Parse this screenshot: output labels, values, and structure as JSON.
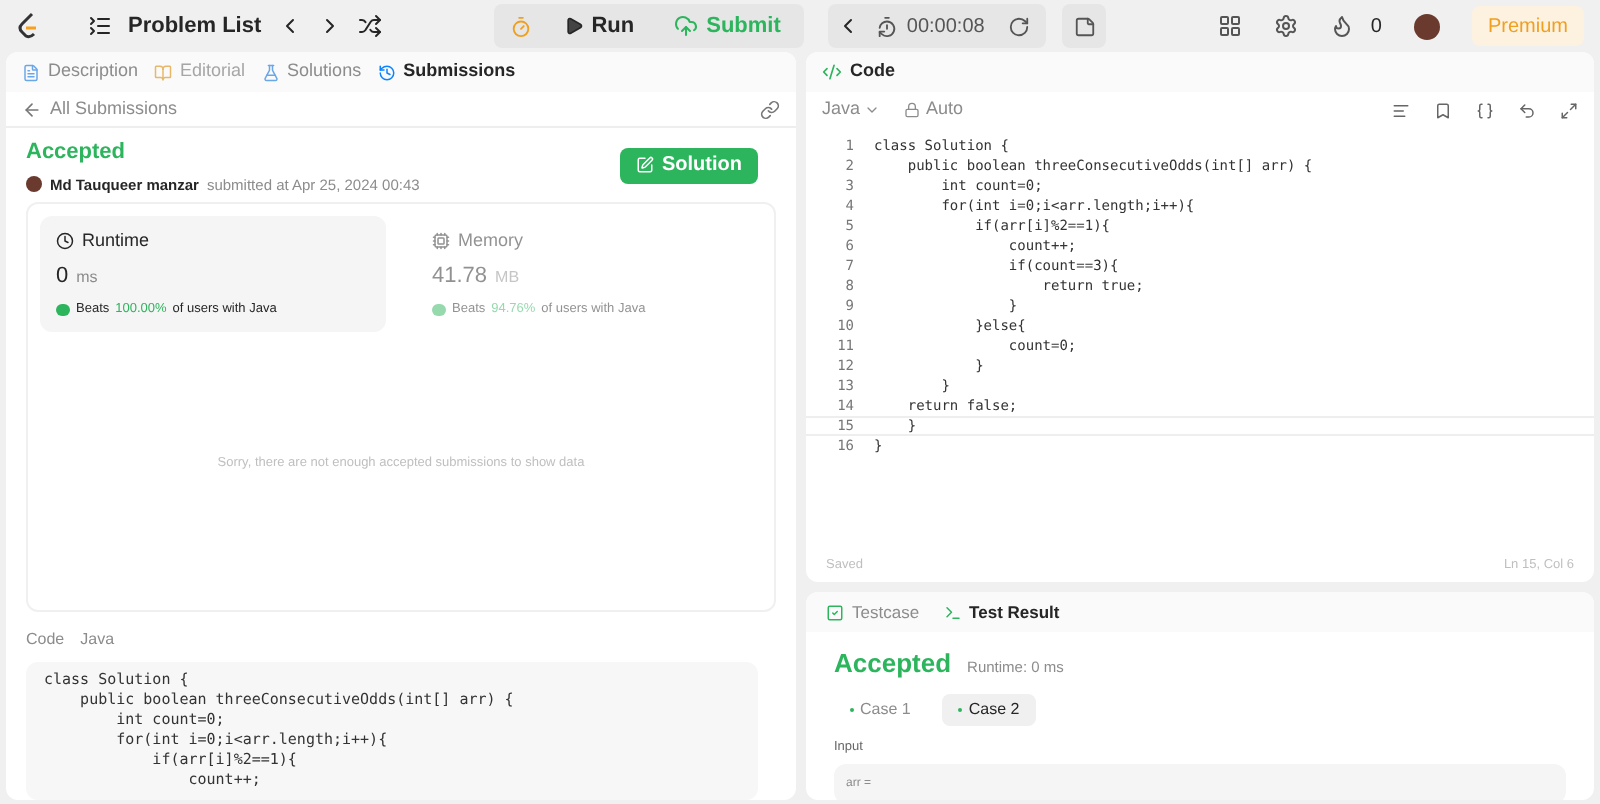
{
  "topbar": {
    "problem_list": "Problem List",
    "run": "Run",
    "submit": "Submit",
    "timer": "00:00:08",
    "streak": "0",
    "premium": "Premium"
  },
  "left_tabs": [
    {
      "label": "Description",
      "selected": false,
      "disabled": false
    },
    {
      "label": "Editorial",
      "selected": false,
      "disabled": true
    },
    {
      "label": "Solutions",
      "selected": false,
      "disabled": false
    },
    {
      "label": "Submissions",
      "selected": true,
      "disabled": false
    }
  ],
  "back_link": "All Submissions",
  "submission": {
    "status": "Accepted",
    "author": "Md Tauqueer manzar",
    "submitted": "submitted at Apr 25, 2024 00:43",
    "solution_button": "Solution"
  },
  "stats": [
    {
      "title": "Runtime",
      "value": "0",
      "unit": "ms",
      "beats_prefix": "Beats",
      "beats": "100.00%",
      "beats_suffix": "of users with Java",
      "selected": true
    },
    {
      "title": "Memory",
      "value": "41.78",
      "unit": "MB",
      "beats_prefix": "Beats",
      "beats": "94.76%",
      "beats_suffix": "of users with Java",
      "selected": false
    }
  ],
  "empty_message": "Sorry, there are not enough accepted submissions to show data",
  "code_label": "Code",
  "code_language": "Java",
  "submitted_code": [
    "class Solution {",
    "    public boolean threeConsecutiveOdds(int[] arr) {",
    "        int count=0;",
    "        for(int i=0;i<arr.length;i++){",
    "            if(arr[i]%2==1){",
    "                count++;"
  ],
  "editor": {
    "title": "Code",
    "language": "Java",
    "mode": "Auto",
    "status": "Saved",
    "cursor": "Ln 15, Col 6",
    "lines": [
      {
        "number": "1",
        "text": "class Solution {"
      },
      {
        "number": "2",
        "text": "    public boolean threeConsecutiveOdds(int[] arr) {"
      },
      {
        "number": "3",
        "text": "        int count=0;"
      },
      {
        "number": "4",
        "text": "        for(int i=0;i<arr.length;i++){"
      },
      {
        "number": "5",
        "text": "            if(arr[i]%2==1){"
      },
      {
        "number": "6",
        "text": "                count++;"
      },
      {
        "number": "7",
        "text": "                if(count==3){"
      },
      {
        "number": "8",
        "text": "                    return true;"
      },
      {
        "number": "9",
        "text": "                }"
      },
      {
        "number": "10",
        "text": "            }else{"
      },
      {
        "number": "11",
        "text": "                count=0;"
      },
      {
        "number": "12",
        "text": "            }"
      },
      {
        "number": "13",
        "text": "        }"
      },
      {
        "number": "14",
        "text": "    return false;"
      },
      {
        "number": "15",
        "text": "    }"
      },
      {
        "number": "16",
        "text": "}"
      }
    ]
  },
  "result_tabs": [
    {
      "label": "Testcase",
      "selected": false
    },
    {
      "label": "Test Result",
      "selected": true
    }
  ],
  "result": {
    "status": "Accepted",
    "runtime": "Runtime: 0 ms",
    "cases": [
      {
        "label": "Case 1",
        "selected": false
      },
      {
        "label": "Case 2",
        "selected": true
      }
    ],
    "input_label": "Input",
    "input_value": "arr ="
  }
}
